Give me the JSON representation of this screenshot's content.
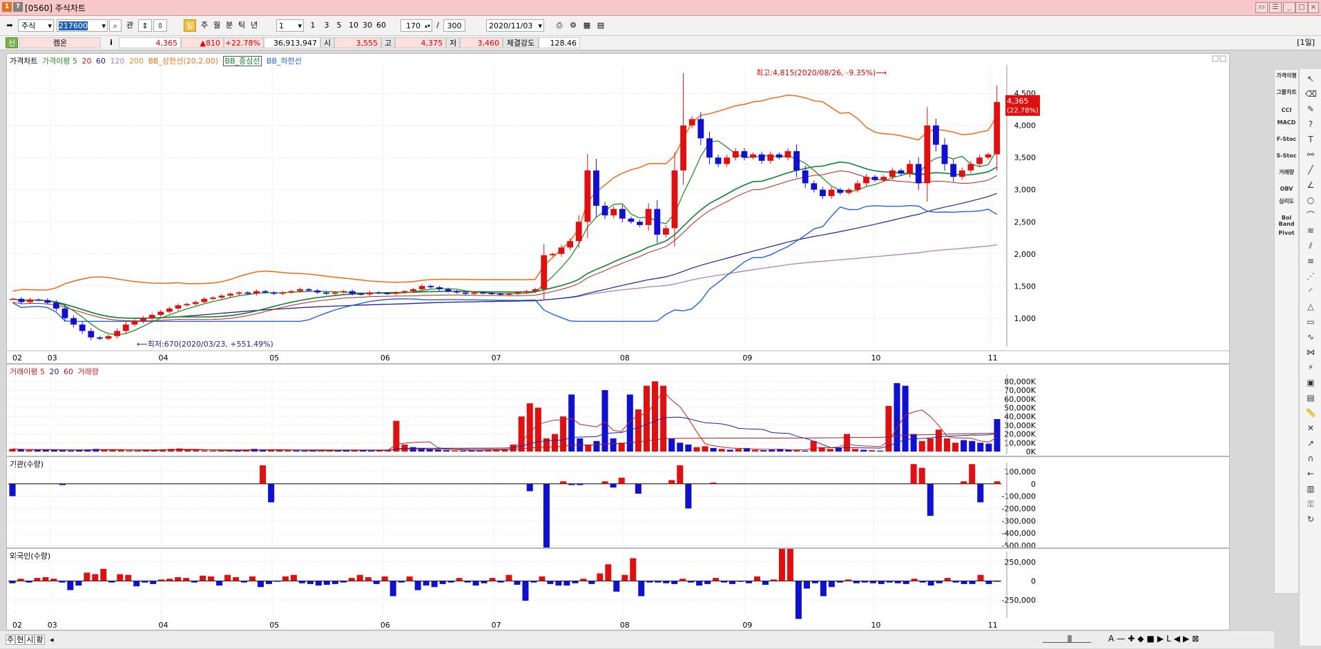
{
  "window": {
    "code": "[0560]",
    "title": "주식차트",
    "icon1": "1",
    "icon2": "?"
  },
  "toolbar": {
    "market": "주식",
    "stock_code": "217600",
    "btn_gwan": "관",
    "periods": [
      "주",
      "월",
      "분",
      "틱",
      "년"
    ],
    "day_icon": "일",
    "interval": "1",
    "minute_options": [
      "1",
      "3",
      "5",
      "10",
      "30",
      "60"
    ],
    "count": "170",
    "separator": "/",
    "total": "300",
    "date": "2020/11/03"
  },
  "quote": {
    "flag": "신",
    "name": "켐온",
    "info_icon": "i",
    "price": "4,365",
    "change": "▲810",
    "rate": "+22.78%",
    "volume": "36,913,947",
    "open_label": "시",
    "open": "3,555",
    "high_label": "고",
    "high": "4,375",
    "low_label": "저",
    "low": "3,460",
    "strength_label": "체결강도",
    "strength": "128.46",
    "period_tag": "[1일]"
  },
  "price_chart": {
    "legend": [
      {
        "text": "가격차트",
        "color": "#000000"
      },
      {
        "text": "가격이평 5",
        "color": "#2a8a2a"
      },
      {
        "text": "20",
        "color": "#c02020"
      },
      {
        "text": "60",
        "color": "#2020a0"
      },
      {
        "text": "120",
        "color": "#b080d0"
      },
      {
        "text": "200",
        "color": "#e09030"
      },
      {
        "text": "BB_상한선(20,2.00)",
        "color": "#f07020"
      },
      {
        "text": "BB_중심선",
        "color": "#108030"
      },
      {
        "text": "BB_하한선",
        "color": "#2060e0"
      }
    ],
    "high_annotation": "최고:4,815(2020/08/26, -9.35%)⟶",
    "low_annotation": "⟵최저:670(2020/03/23, +551.49%)",
    "y_ticks": [
      "4,500",
      "4,000",
      "3,500",
      "3,000",
      "2,500",
      "2,000",
      "1,500",
      "1,000"
    ],
    "last_price_tag": "4,365",
    "last_rate_tag": "(22.78%)"
  },
  "volume_chart": {
    "legend": [
      {
        "text": "거래이평 5",
        "color": "#c02020"
      },
      {
        "text": "20",
        "color": "#2020a0"
      },
      {
        "text": "60",
        "color": "#a02020"
      },
      {
        "text": "거래량",
        "color": "#c02020"
      }
    ],
    "y_ticks": [
      "80,000K",
      "70,000K",
      "60,000K",
      "50,000K",
      "40,000K",
      "30,000K",
      "20,000K",
      "10,000K",
      "0K"
    ]
  },
  "inst_chart": {
    "legend": "기관(수량)",
    "y_ticks": [
      "100,000",
      "0",
      "-100,000",
      "-200,000",
      "-300,000",
      "-400,000",
      "-500,000"
    ]
  },
  "foreign_chart": {
    "legend": "외국인(수량)",
    "y_ticks": [
      "250,000",
      "0",
      "-250,000"
    ]
  },
  "x_axis": {
    "labels": [
      "02",
      "03",
      "04",
      "05",
      "06",
      "07",
      "08",
      "09",
      "10",
      "11"
    ]
  },
  "bottom_tabs": [
    "주",
    "현",
    "시",
    "황"
  ],
  "bottom_controls": [
    "A",
    "—",
    "✚",
    "◆",
    "■",
    "▶",
    "L",
    "◀",
    "▶",
    "⊠"
  ],
  "indicators": [
    "가격이평",
    "그물차트",
    "CCI",
    "MACD",
    "F-Stoc",
    "S-Stoc",
    "거래량",
    "OBV",
    "심리도",
    "Bol Band",
    "Pivot"
  ],
  "chart_data": [
    {
      "type": "candlestick",
      "title": "가격차트",
      "x_range": [
        "2020/02",
        "2020/11/03"
      ],
      "ylim": [
        600,
        4900
      ],
      "high": {
        "value": 4815,
        "date": "2020/08/26"
      },
      "low": {
        "value": 670,
        "date": "2020/03/23"
      },
      "last": 4365,
      "close_path": [
        1300,
        1250,
        1290,
        1280,
        1240,
        1150,
        1000,
        900,
        800,
        700,
        680,
        720,
        800,
        900,
        950,
        1000,
        1050,
        1100,
        1150,
        1200,
        1220,
        1250,
        1300,
        1320,
        1350,
        1380,
        1400,
        1380,
        1420,
        1400,
        1380,
        1400,
        1420,
        1450,
        1430,
        1400,
        1380,
        1400,
        1420,
        1380,
        1370,
        1400,
        1390,
        1380,
        1400,
        1420,
        1450,
        1500,
        1480,
        1450,
        1420,
        1400,
        1380,
        1400,
        1390,
        1380,
        1370,
        1380,
        1400,
        1420,
        1450,
        1980,
        2000,
        2100,
        2200,
        2500,
        3300,
        2750,
        2600,
        2700,
        2550,
        2500,
        2450,
        2700,
        2300,
        2400,
        3300,
        4000,
        4100,
        3800,
        3500,
        3400,
        3500,
        3600,
        3500,
        3550,
        3450,
        3550,
        3500,
        3600,
        3300,
        3100,
        3000,
        2900,
        3000,
        2950,
        3000,
        3100,
        3200,
        3150,
        3200,
        3300,
        3250,
        3400,
        3100,
        4000,
        3700,
        3400,
        3200,
        3300,
        3400,
        3500,
        3550,
        4365
      ]
    },
    {
      "type": "bar",
      "title": "거래량",
      "unit": "K",
      "ylim": [
        0,
        85000
      ],
      "values_K": [
        3000,
        2000,
        1500,
        2000,
        2500,
        1800,
        1500,
        1200,
        2000,
        2500,
        3000,
        2000,
        2000,
        1500,
        1200,
        1000,
        1500,
        2000,
        2500,
        3000,
        3500,
        2000,
        1500,
        1200,
        1000,
        1000,
        800,
        1500,
        2000,
        3000,
        2500,
        2000,
        1500,
        1200,
        1000,
        800,
        1000,
        1200,
        1500,
        1800,
        2000,
        1500,
        1200,
        1000,
        1500,
        2000,
        35000,
        8000,
        5000,
        4000,
        3000,
        2000,
        1500,
        1200,
        1000,
        1200,
        1500,
        2000,
        2500,
        3000,
        8000,
        40000,
        55000,
        50000,
        15000,
        20000,
        40000,
        65000,
        15000,
        8000,
        12000,
        70000,
        15000,
        10000,
        65000,
        48000,
        75000,
        80000,
        75000,
        15000,
        10000,
        8000,
        5000,
        6000,
        4000,
        3000,
        2000,
        3000,
        4000,
        2000,
        1500,
        2000,
        3000,
        2000,
        1500,
        1000,
        12000,
        5000,
        3000,
        4000,
        20000,
        3000,
        2000,
        1500,
        1000,
        52000,
        78000,
        75000,
        20000,
        12000,
        15000,
        25000,
        15000,
        10000,
        13000,
        12000,
        10000,
        9000,
        37000
      ]
    },
    {
      "type": "bar",
      "title": "기관(수량)",
      "ylim": [
        -500000,
        150000
      ],
      "values": [
        -100000,
        0,
        0,
        0,
        0,
        0,
        -10000,
        0,
        0,
        0,
        0,
        0,
        0,
        0,
        0,
        0,
        0,
        0,
        0,
        0,
        0,
        0,
        0,
        0,
        0,
        0,
        0,
        0,
        0,
        0,
        150000,
        -150000,
        0,
        0,
        0,
        0,
        0,
        0,
        0,
        0,
        0,
        0,
        0,
        0,
        0,
        0,
        0,
        0,
        0,
        0,
        0,
        0,
        0,
        0,
        0,
        0,
        0,
        0,
        0,
        0,
        0,
        0,
        -60000,
        0,
        -600000,
        0,
        20000,
        -10000,
        -10000,
        0,
        0,
        20000,
        -30000,
        50000,
        0,
        -80000,
        0,
        0,
        0,
        30000,
        150000,
        -200000,
        0,
        0,
        10000,
        0,
        0,
        0,
        0,
        0,
        0,
        0,
        0,
        0,
        0,
        0,
        0,
        0,
        0,
        0,
        0,
        0,
        0,
        0,
        0,
        0,
        0,
        0,
        160000,
        130000,
        -260000,
        0,
        0,
        0,
        20000,
        160000,
        -150000,
        0,
        20000
      ]
    },
    {
      "type": "bar",
      "title": "외국인(수량)",
      "ylim": [
        -450000,
        350000
      ],
      "values": [
        -30000,
        30000,
        -20000,
        40000,
        50000,
        30000,
        -20000,
        -120000,
        -60000,
        110000,
        90000,
        160000,
        -20000,
        90000,
        80000,
        -70000,
        -20000,
        -40000,
        20000,
        30000,
        50000,
        40000,
        -20000,
        70000,
        60000,
        -60000,
        80000,
        50000,
        -20000,
        60000,
        -80000,
        -40000,
        -10000,
        60000,
        80000,
        -30000,
        -40000,
        -60000,
        -50000,
        -40000,
        -20000,
        40000,
        80000,
        50000,
        -40000,
        60000,
        -200000,
        -20000,
        60000,
        -120000,
        -60000,
        -80000,
        -40000,
        -20000,
        40000,
        -20000,
        -60000,
        -30000,
        40000,
        -20000,
        80000,
        -50000,
        -260000,
        -20000,
        60000,
        -40000,
        -60000,
        -60000,
        -30000,
        30000,
        -40000,
        100000,
        220000,
        -140000,
        80000,
        300000,
        -200000,
        -20000,
        -20000,
        -30000,
        -40000,
        30000,
        -20000,
        -60000,
        -40000,
        40000,
        -20000,
        -40000,
        -10000,
        -30000,
        60000,
        -50000,
        20000,
        500000,
        480000,
        -500000,
        -100000,
        -30000,
        -200000,
        -80000,
        -20000,
        20000,
        -30000,
        -20000,
        -30000,
        -40000,
        -20000,
        -30000,
        -40000,
        30000,
        -20000,
        -60000,
        -30000,
        40000,
        -20000,
        -40000,
        -40000,
        80000,
        -40000,
        -10000
      ]
    }
  ]
}
